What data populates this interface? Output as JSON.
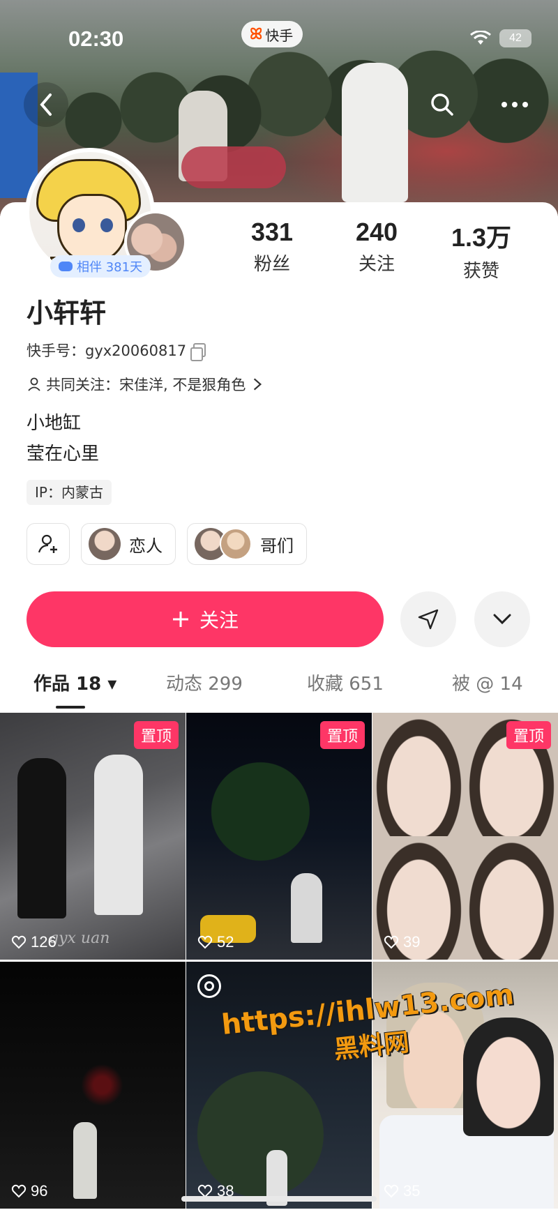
{
  "status_bar": {
    "time": "02:30",
    "app_name": "快手",
    "battery": "42"
  },
  "nav": {
    "back_icon": "chevron-left-icon",
    "search_icon": "search-icon",
    "more_icon": "more-icon"
  },
  "profile": {
    "name": "小轩轩",
    "account_label": "快手号：gyx20060817",
    "mutual_follow": "共同关注：宋佳洋, 不是狠角色",
    "bio_lines": [
      "小地缸",
      "莹在心里"
    ],
    "ip": "IP：内蒙古",
    "companion_badge": "相伴 381天"
  },
  "stats": [
    {
      "value": "331",
      "label": "粉丝"
    },
    {
      "value": "240",
      "label": "关注"
    },
    {
      "value": "1.3万",
      "label": "获赞"
    }
  ],
  "relations": [
    {
      "label": "恋人"
    },
    {
      "label": "哥们"
    }
  ],
  "actions": {
    "follow": "关注"
  },
  "tabs": [
    {
      "label": "作品 18 ▾",
      "active": true
    },
    {
      "label": "动态 299",
      "active": false
    },
    {
      "label": "收藏 651",
      "active": false
    },
    {
      "label": "被 @ 14",
      "active": false
    }
  ],
  "videos": [
    {
      "likes": "126",
      "pinned": "置顶",
      "overlay_text": "gyx uan"
    },
    {
      "likes": "52",
      "pinned": "置顶"
    },
    {
      "likes": "39",
      "pinned": "置顶"
    },
    {
      "likes": "96"
    },
    {
      "likes": "38"
    },
    {
      "likes": "35"
    }
  ],
  "watermark": {
    "line1": "https://ihlw13.com",
    "line2": "黑料网"
  },
  "colors": {
    "accent": "#fe3666",
    "companion_blue": "#4f86f7",
    "watermark_orange": "#f39a10"
  }
}
